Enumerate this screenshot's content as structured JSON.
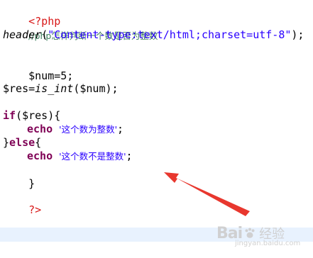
{
  "code": {
    "open_tag": "<?php",
    "comment": "//php怎样判断一个数是否为整数",
    "header_fn": "header",
    "header_open": "(",
    "header_str": "\"Content-type:text/html;charset=utf-8\"",
    "header_close": ");",
    "num_line": "$num=5;",
    "res_var": "$res=",
    "res_fn": "is_int",
    "res_args": "($num);",
    "if_kw": "if",
    "if_cond": "($res){",
    "echo1_kw": "echo",
    "echo1_str": "'这个数为整数'",
    "echo1_end": ";",
    "else_open": "}",
    "else_kw": "else",
    "else_brace": "{",
    "echo2_kw": "echo",
    "echo2_str": "'这个数不是整数'",
    "echo2_end": ";",
    "close_brace": "}",
    "close_tag": "?>"
  },
  "watermark": {
    "brand": "Bai",
    "brand2": "经验",
    "url": "jingyan.baidu.com"
  },
  "colors": {
    "php_tag": "#d81818",
    "comment": "#3f7f5f",
    "string": "#2a00ff",
    "keyword": "#7f0055",
    "current_line": "#e8f2fe",
    "arrow": "#e8372e"
  }
}
